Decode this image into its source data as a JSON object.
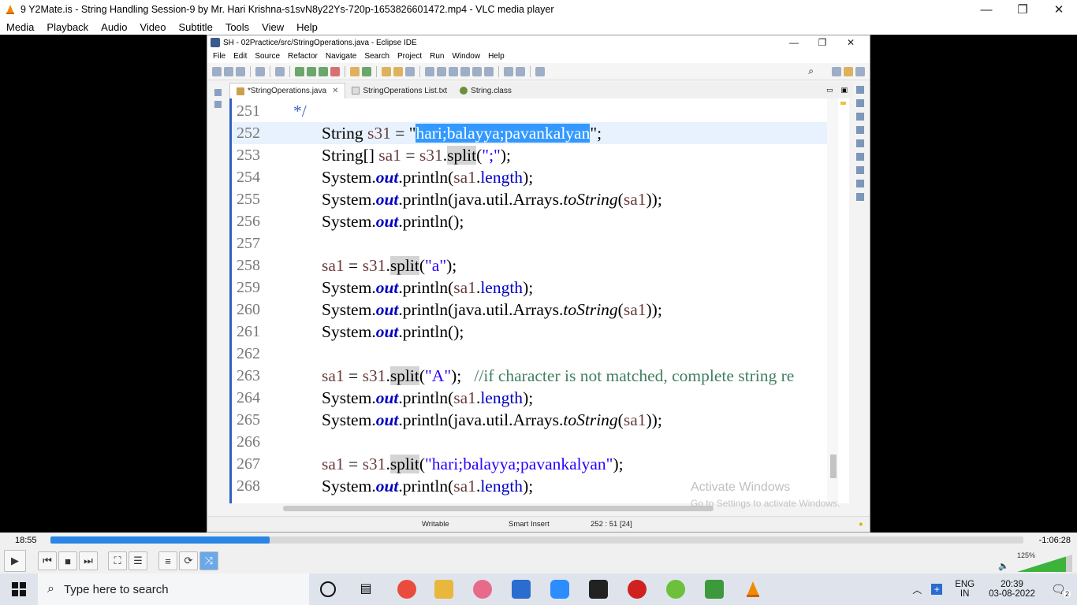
{
  "vlc": {
    "title": "9 Y2Mate.is - String Handling Session-9  by Mr. Hari Krishna-s1svN8y22Ys-720p-1653826601472.mp4 - VLC media player",
    "menu": [
      "Media",
      "Playback",
      "Audio",
      "Video",
      "Subtitle",
      "Tools",
      "View",
      "Help"
    ],
    "elapsed": "18:55",
    "remaining": "-1:06:28",
    "progress_percent": 22.5,
    "volume": "125%"
  },
  "eclipse": {
    "title": "SH - 02Practice/src/StringOperations.java - Eclipse IDE",
    "menu": [
      "File",
      "Edit",
      "Source",
      "Refactor",
      "Navigate",
      "Search",
      "Project",
      "Run",
      "Window",
      "Help"
    ],
    "tabs": [
      {
        "label": "*StringOperations.java",
        "active": true
      },
      {
        "label": "StringOperations List.txt",
        "active": false
      },
      {
        "label": "String.class",
        "active": false
      }
    ],
    "status": {
      "writable": "Writable",
      "insert_mode": "Smart Insert",
      "position": "252 : 51 [24]"
    }
  },
  "code": {
    "lines": [
      {
        "n": "251",
        "text": "*/"
      },
      {
        "n": "252",
        "text": "String s31 = \"hari;balayya;pavankalyan\";"
      },
      {
        "n": "253",
        "text": "String[] sa1 = s31.split(\";\");"
      },
      {
        "n": "254",
        "text": "System.out.println(sa1.length);"
      },
      {
        "n": "255",
        "text": "System.out.println(java.util.Arrays.toString(sa1));"
      },
      {
        "n": "256",
        "text": "System.out.println();"
      },
      {
        "n": "257",
        "text": ""
      },
      {
        "n": "258",
        "text": "sa1 = s31.split(\"a\");"
      },
      {
        "n": "259",
        "text": "System.out.println(sa1.length);"
      },
      {
        "n": "260",
        "text": "System.out.println(java.util.Arrays.toString(sa1));"
      },
      {
        "n": "261",
        "text": "System.out.println();"
      },
      {
        "n": "262",
        "text": ""
      },
      {
        "n": "263",
        "text": "sa1 = s31.split(\"A\");   //if character is not matched, complete string re"
      },
      {
        "n": "264",
        "text": "System.out.println(sa1.length);"
      },
      {
        "n": "265",
        "text": "System.out.println(java.util.Arrays.toString(sa1));"
      },
      {
        "n": "266",
        "text": ""
      },
      {
        "n": "267",
        "text": "sa1 = s31.split(\"hari;balayya;pavankalyan\");"
      },
      {
        "n": "268",
        "text": "System.out.println(sa1.length);"
      }
    ]
  },
  "watermark": {
    "line1": "Activate Windows",
    "line2": "Go to Settings to activate Windows."
  },
  "taskbar": {
    "search_placeholder": "Type here to search",
    "lang1": "ENG",
    "lang2": "IN",
    "time": "20:39",
    "date": "03-08-2022",
    "notifications": "2"
  }
}
